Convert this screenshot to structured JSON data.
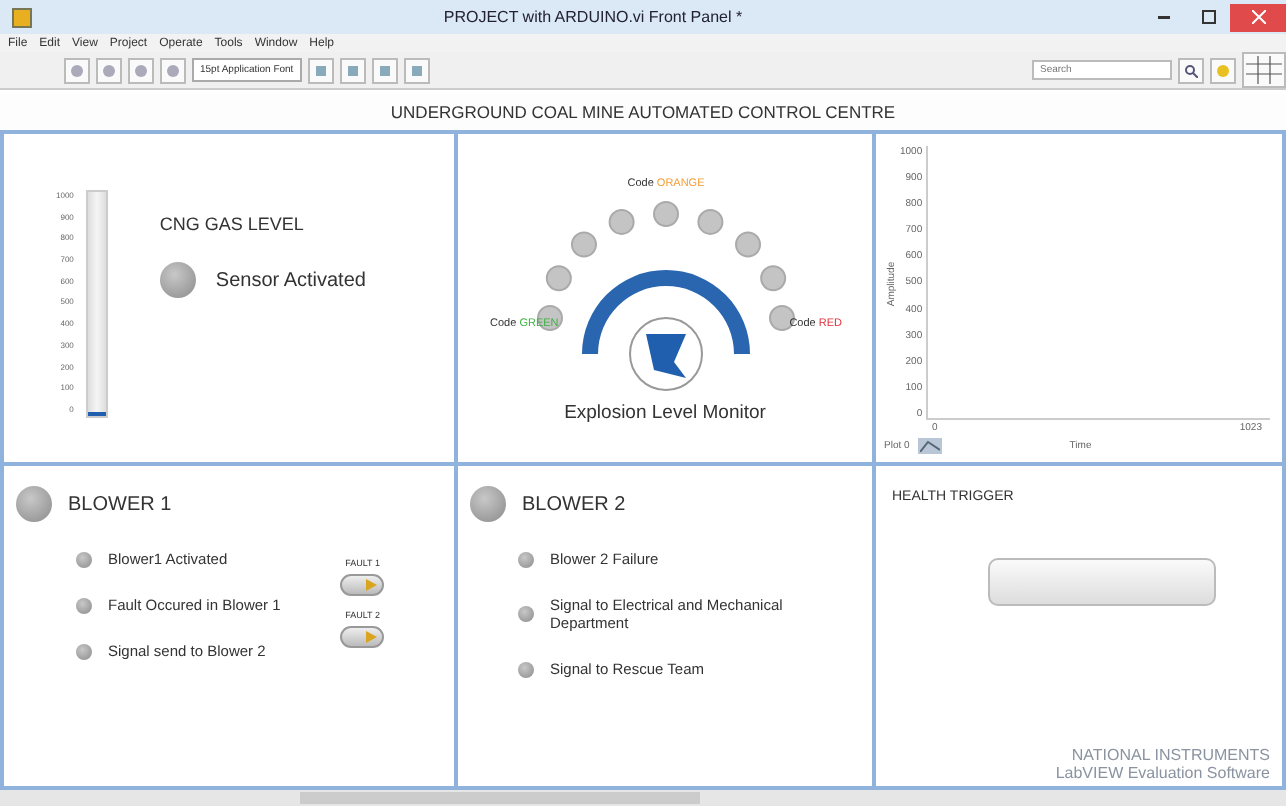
{
  "window": {
    "title": "PROJECT with ARDUINO.vi Front Panel *"
  },
  "menu": [
    "File",
    "Edit",
    "View",
    "Project",
    "Operate",
    "Tools",
    "Window",
    "Help"
  ],
  "toolbar": {
    "font": "15pt Application Font",
    "search": {
      "placeholder": "Search"
    }
  },
  "header": "UNDERGROUND COAL MINE AUTOMATED CONTROL CENTRE",
  "gas": {
    "ticks": [
      "1000",
      "900",
      "800",
      "700",
      "600",
      "500",
      "400",
      "300",
      "200",
      "100",
      "0"
    ],
    "level": 0.02,
    "label": "CNG GAS LEVEL",
    "sensor": {
      "label": "Sensor Activated",
      "on": false
    }
  },
  "explosion": {
    "title": "Explosion Level Monitor",
    "codes": [
      {
        "label": "Code",
        "value": "GREEN",
        "color": "#3cb043"
      },
      {
        "label": "Code",
        "value": "ORANGE",
        "color": "#f39c34"
      },
      {
        "label": "Code",
        "value": "RED",
        "color": "#e0303a"
      }
    ],
    "leds": [
      {
        "on": false
      },
      {
        "on": false
      },
      {
        "on": false
      },
      {
        "on": false
      },
      {
        "on": false
      },
      {
        "on": false
      },
      {
        "on": false
      },
      {
        "on": false
      },
      {
        "on": false
      }
    ]
  },
  "graph": {
    "ylabel": "Amplitude",
    "xlabel": "Time",
    "yticks": [
      "1000",
      "900",
      "800",
      "700",
      "600",
      "500",
      "400",
      "300",
      "200",
      "100",
      "0"
    ],
    "xticks": [
      "0",
      "1023"
    ],
    "legend": "Plot 0"
  },
  "blower1": {
    "title": "BLOWER 1",
    "on": false,
    "items": [
      {
        "label": "Blower1 Activated",
        "on": false
      },
      {
        "label": "Fault Occured in Blower 1",
        "on": false
      },
      {
        "label": "Signal send to Blower 2",
        "on": false
      }
    ],
    "switches": [
      {
        "label": "FAULT 1"
      },
      {
        "label": "FAULT 2"
      }
    ]
  },
  "blower2": {
    "title": "BLOWER 2",
    "on": false,
    "items": [
      {
        "label": "Blower 2 Failure",
        "on": false
      },
      {
        "label": "Signal to Electrical and Mechanical Department",
        "on": false
      },
      {
        "label": "Signal to Rescue Team",
        "on": false
      }
    ]
  },
  "health": {
    "title": "HEALTH TRIGGER",
    "on": false
  },
  "evaluation": {
    "brand": "NATIONAL INSTRUMENTS",
    "note": "LabVIEW Evaluation Software"
  }
}
